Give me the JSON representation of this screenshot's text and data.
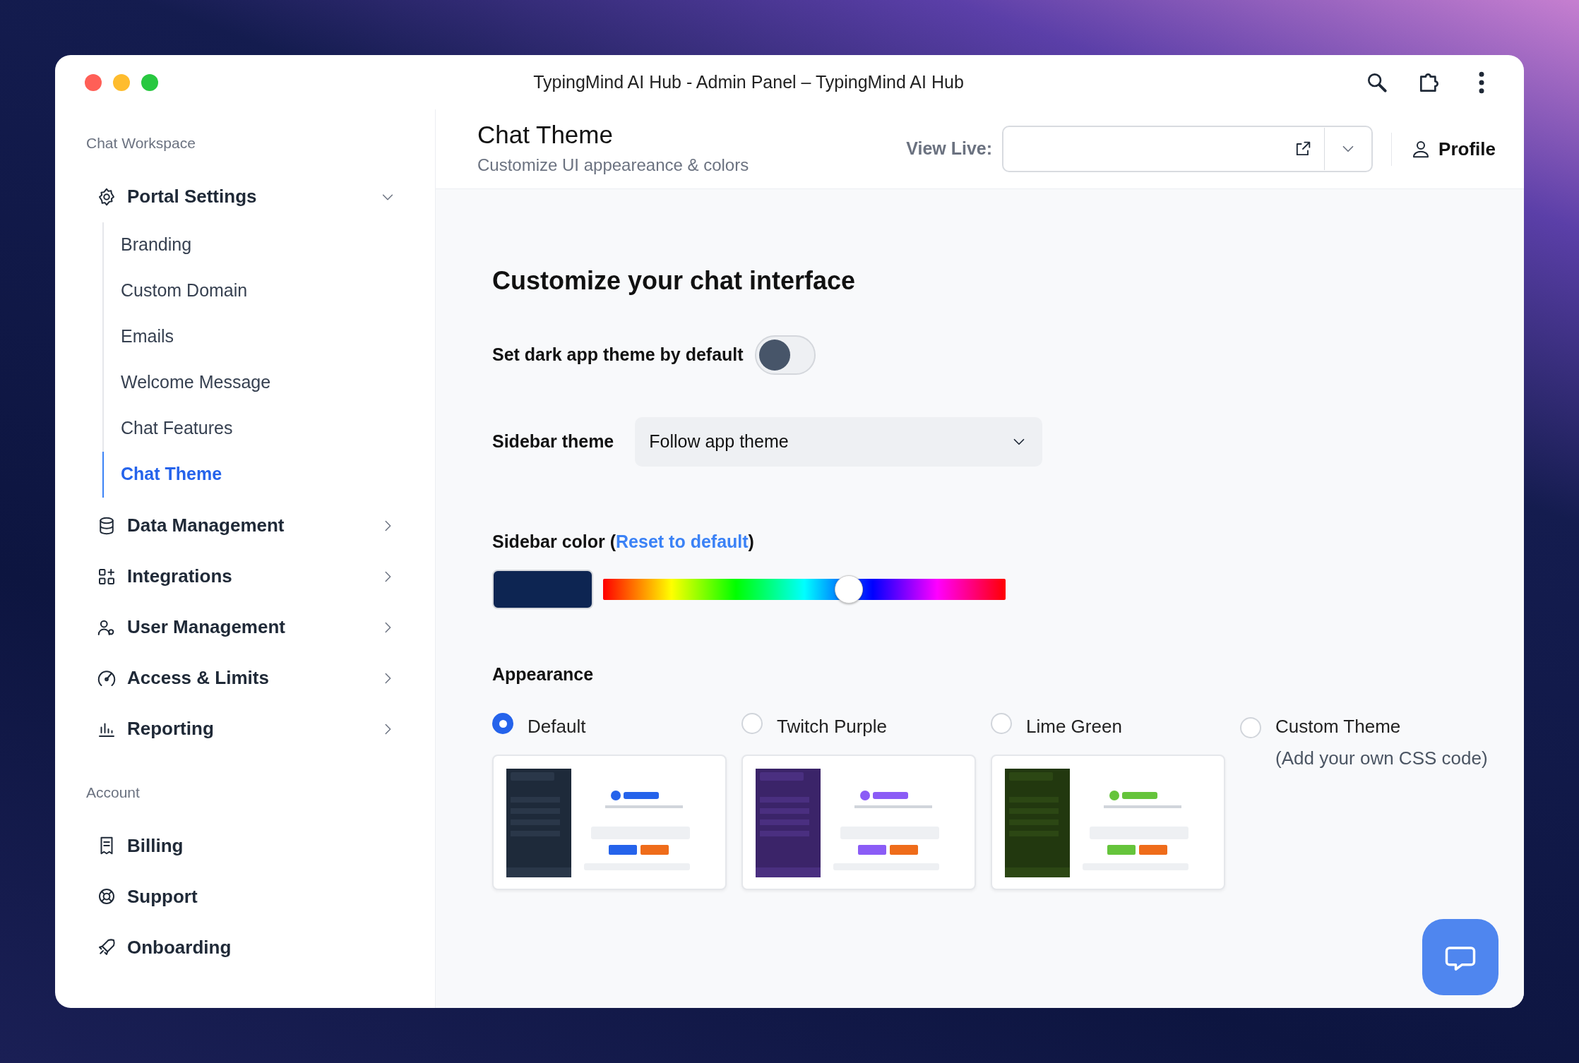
{
  "window": {
    "title": "TypingMind AI Hub - Admin Panel – TypingMind AI Hub"
  },
  "sidebar": {
    "sections": [
      {
        "heading": "Chat Workspace",
        "items": [
          {
            "label": "Portal Settings",
            "expanded": true,
            "children": [
              {
                "label": "Branding",
                "selected": false
              },
              {
                "label": "Custom Domain",
                "selected": false
              },
              {
                "label": "Emails",
                "selected": false
              },
              {
                "label": "Welcome Message",
                "selected": false
              },
              {
                "label": "Chat Features",
                "selected": false
              },
              {
                "label": "Chat Theme",
                "selected": true
              }
            ]
          },
          {
            "label": "Data Management",
            "expanded": false
          },
          {
            "label": "Integrations",
            "expanded": false
          },
          {
            "label": "User Management",
            "expanded": false
          },
          {
            "label": "Access & Limits",
            "expanded": false
          },
          {
            "label": "Reporting",
            "expanded": false
          }
        ]
      },
      {
        "heading": "Account",
        "items": [
          {
            "label": "Billing"
          },
          {
            "label": "Support"
          },
          {
            "label": "Onboarding"
          }
        ]
      }
    ]
  },
  "header": {
    "title": "Chat Theme",
    "subtitle": "Customize UI appeareance & colors",
    "view_live_label": "View Live:",
    "profile": "Profile"
  },
  "main": {
    "heading": "Customize your chat interface",
    "dark_toggle": {
      "label": "Set dark app theme by default",
      "on": false
    },
    "sidebar_theme": {
      "label": "Sidebar theme",
      "value": "Follow app theme"
    },
    "sidebar_color": {
      "label_before": "Sidebar color (",
      "link": "Reset to default",
      "label_after": ")",
      "color": "#0d2552",
      "level": 0.61
    },
    "appearance": {
      "heading": "Appearance",
      "options": [
        {
          "label": "Default",
          "selected": true
        },
        {
          "label": "Twitch Purple",
          "selected": false
        },
        {
          "label": "Lime Green",
          "selected": false
        },
        {
          "label": "Custom Theme",
          "note": "(Add your own CSS code)",
          "selected": false
        }
      ]
    }
  }
}
